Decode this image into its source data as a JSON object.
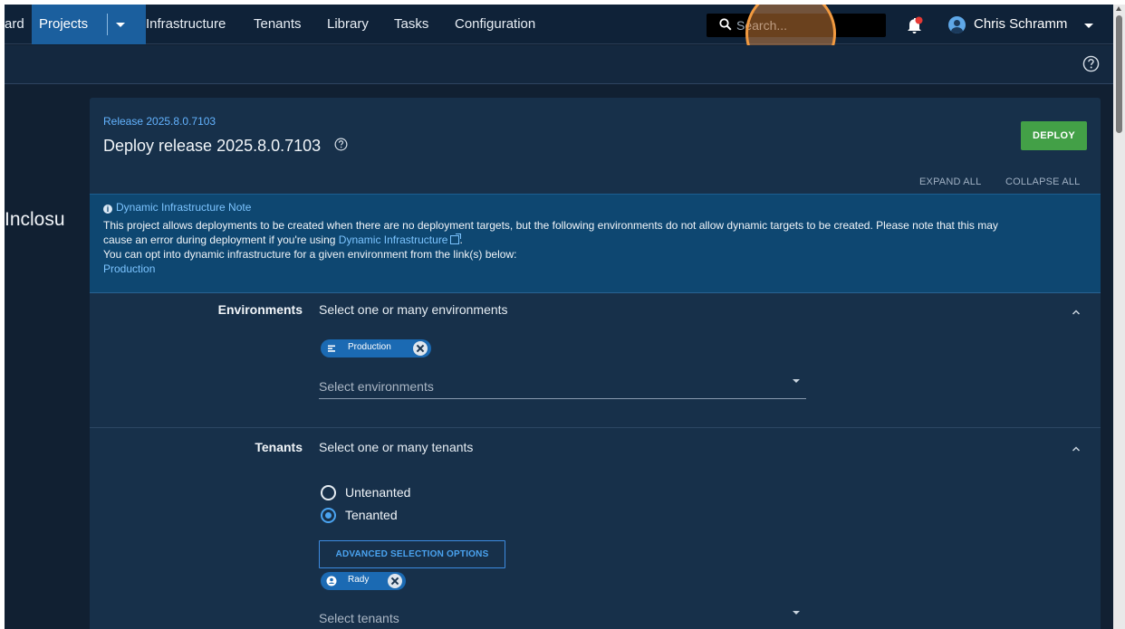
{
  "nav": {
    "cut_item": "ard",
    "projects": "Projects",
    "items": [
      "Infrastructure",
      "Tenants",
      "Library",
      "Tasks",
      "Configuration"
    ],
    "search_placeholder": "Search...",
    "user_name": "Chris Schramm"
  },
  "page": {
    "left_title": "Inclosu"
  },
  "release": {
    "link": "Release 2025.8.0.7103",
    "title": "Deploy release 2025.8.0.7103",
    "deploy_label": "DEPLOY",
    "expand_all": "EXPAND ALL",
    "collapse_all": "COLLAPSE ALL"
  },
  "note": {
    "title": "Dynamic Infrastructure Note",
    "line1": "This project allows deployments to be created when there are no deployment targets, but the following environments do not allow dynamic targets to be created. Please note that this may",
    "line2_pre": "cause an error during deployment if you're using ",
    "line2_link": "Dynamic Infrastructure",
    "line2_post": ".",
    "line3": "You can opt into dynamic infrastructure for a given environment from the link(s) below:",
    "env_link": "Production"
  },
  "environments": {
    "label": "Environments",
    "description": "Select one or many environments",
    "chips": [
      "Production"
    ],
    "placeholder": "Select environments"
  },
  "tenants": {
    "label": "Tenants",
    "description": "Select one or many tenants",
    "options": [
      {
        "label": "Untenanted",
        "selected": false
      },
      {
        "label": "Tenanted",
        "selected": true
      }
    ],
    "advanced_label": "ADVANCED SELECTION OPTIONS",
    "chips": [
      "Rady"
    ],
    "placeholder": "Select tenants"
  },
  "colors": {
    "background": "#112032",
    "card": "#17304a",
    "accent": "#1b6ab3",
    "deploy": "#43a047",
    "note": "#0e4771"
  }
}
